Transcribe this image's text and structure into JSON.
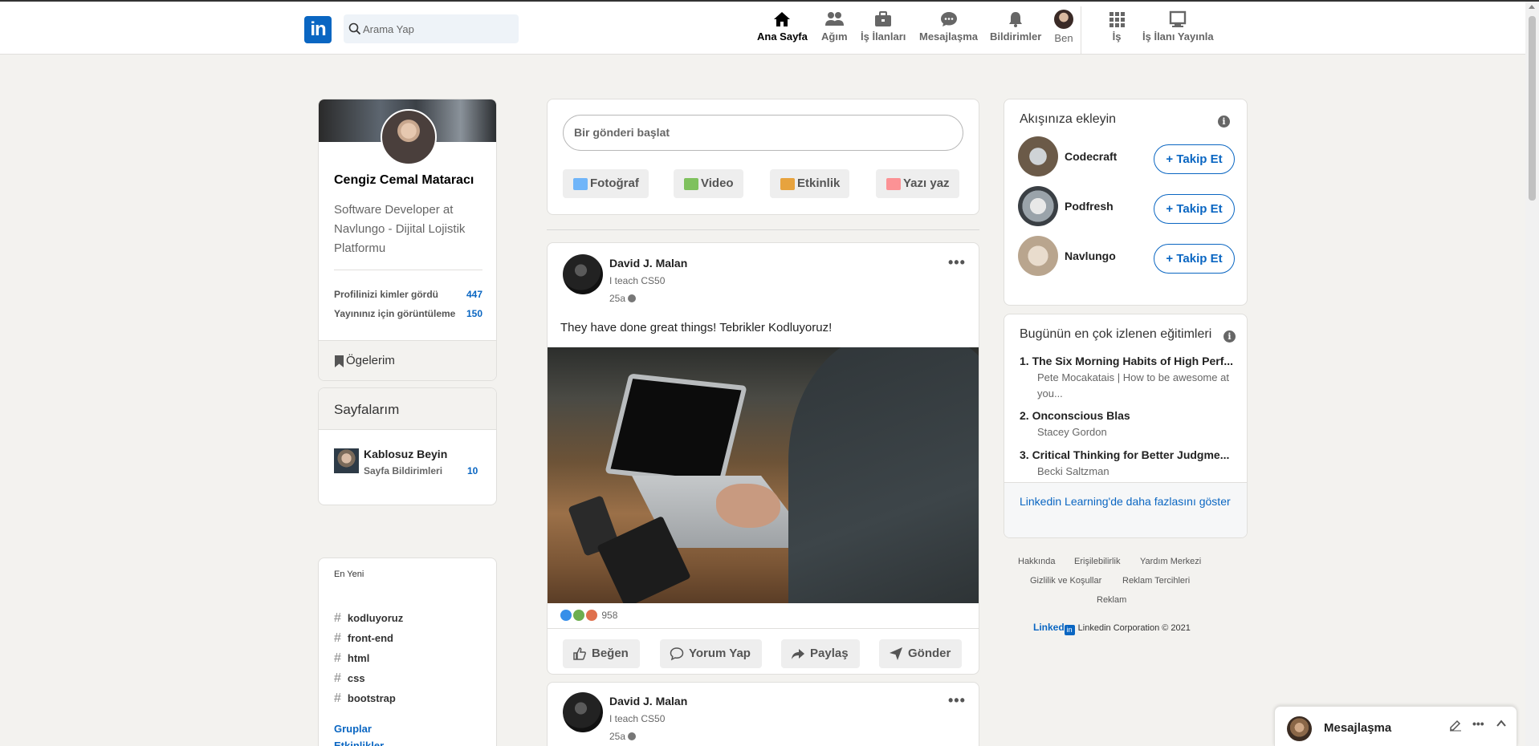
{
  "nav": {
    "search_placeholder": "Arama Yap",
    "items": [
      {
        "label": "Ana Sayfa"
      },
      {
        "label": "Ağım"
      },
      {
        "label": "İş İlanları"
      },
      {
        "label": "Mesajlaşma"
      },
      {
        "label": "Bildirimler"
      },
      {
        "label": "Ben"
      },
      {
        "label": "İş"
      },
      {
        "label": "İş İlanı Yayınla"
      }
    ]
  },
  "profile": {
    "name": "Cengiz Cemal Mataracı",
    "headline": "Software Developer at Navlungo - Dijital Lojistik Platformu",
    "stats": [
      {
        "label": "Profilinizi kimler gördü",
        "value": "447"
      },
      {
        "label": "Yayınınız için görüntüleme",
        "value": "150"
      }
    ],
    "items_label": "Ögelerim"
  },
  "pages": {
    "title": "Sayfalarım",
    "page_name": "Kablosuz Beyin",
    "notifications_label": "Sayfa Bildirimleri",
    "notifications_count": "10"
  },
  "recent": {
    "title": "En Yeni",
    "hashtags": [
      "kodluyoruz",
      "front-end",
      "html",
      "css",
      "bootstrap"
    ],
    "groups_label": "Gruplar",
    "events_label": "Etkinlikler"
  },
  "share": {
    "placeholder": "Bir gönderi başlat",
    "buttons": [
      {
        "label": "Fotoğraf",
        "color": "#70b5f9"
      },
      {
        "label": "Video",
        "color": "#7fc15e"
      },
      {
        "label": "Etkinlik",
        "color": "#e7a33e"
      },
      {
        "label": "Yazı yaz",
        "color": "#fc9295"
      }
    ]
  },
  "posts": [
    {
      "author": "David J. Malan",
      "subtitle": "I teach CS50",
      "time": "25a",
      "text": "They have done great things! Tebrikler Kodluyoruz!",
      "reactions": "958",
      "actions": [
        "Beğen",
        "Yorum Yap",
        "Paylaş",
        "Gönder"
      ]
    },
    {
      "author": "David J. Malan",
      "subtitle": "I teach CS50",
      "time": "25a"
    }
  ],
  "follow": {
    "title": "Akışınıza ekleyin",
    "button_label": "+ Takip Et",
    "suggestions": [
      {
        "name": "Codecraft"
      },
      {
        "name": "Podfresh"
      },
      {
        "name": "Navlungo"
      }
    ]
  },
  "courses": {
    "title": "Bugünün en çok izlenen eğitimleri",
    "items": [
      {
        "title": "1. The Six Morning Habits of High Perf...",
        "author": "Pete Mocakatais | How to be awesome at you..."
      },
      {
        "title": "2. Onconscious Blas",
        "author": "Stacey Gordon"
      },
      {
        "title": "3. Critical Thinking for Better Judgme...",
        "author": "Becki Saltzman"
      }
    ],
    "more_link": "Linkedin Learning'de daha fazlasını göster"
  },
  "footer": {
    "links": [
      "Hakkında",
      "Erişilebilirlik",
      "Yardım Merkezi",
      "Gizlilik ve Koşullar",
      "Reklam Tercihleri",
      "Reklam"
    ],
    "brand_text": "Linked",
    "copyright": "Linkedin Corporation © 2021"
  },
  "messaging": {
    "title": "Mesajlaşma"
  }
}
